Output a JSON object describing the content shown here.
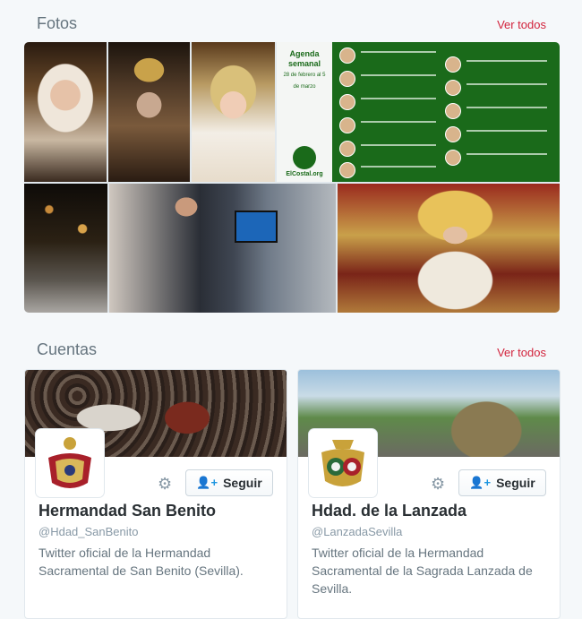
{
  "photos_section": {
    "title": "Fotos",
    "see_all": "Ver todos",
    "infographic": {
      "title_line1": "Agenda",
      "title_line2": "semanal",
      "dates": "28 de febrero al 5 de marzo",
      "site": "ElCostal.org"
    }
  },
  "accounts_section": {
    "title": "Cuentas",
    "see_all": "Ver todos"
  },
  "accounts": [
    {
      "name": "Hermandad San Benito",
      "handle": "@Hdad_SanBenito",
      "bio": "Twitter oficial de la Hermandad Sacramental de San Benito (Sevilla).",
      "follow_label": "Seguir"
    },
    {
      "name": "Hdad. de la Lanzada",
      "handle": "@LanzadaSevilla",
      "bio": "Twitter oficial de la Hermandad Sacramental de la Sagrada Lanzada de Sevilla.",
      "follow_label": "Seguir"
    }
  ],
  "colors": {
    "accent": "#d2233c",
    "follow_icon": "#1b95e0",
    "infographic_green": "#1a6a1a"
  },
  "icons": {
    "settings": "gear-icon",
    "follow": "add-user-icon"
  }
}
